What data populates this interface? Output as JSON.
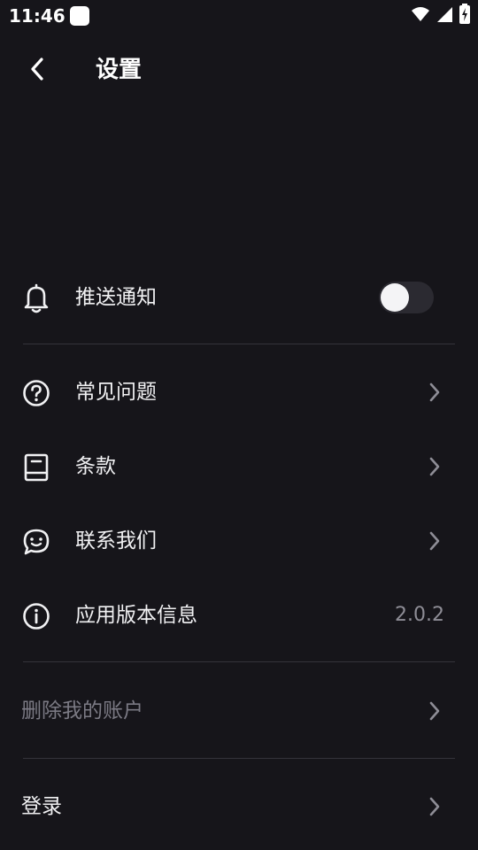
{
  "status_bar": {
    "time": "11:46"
  },
  "header": {
    "title": "设置"
  },
  "settings": {
    "notifications": {
      "label": "推送通知",
      "enabled": false
    },
    "faq": {
      "label": "常见问题"
    },
    "terms": {
      "label": "条款"
    },
    "contact": {
      "label": "联系我们"
    },
    "version": {
      "label": "应用版本信息",
      "value": "2.0.2"
    },
    "delete_account": {
      "label": "删除我的账户"
    },
    "login": {
      "label": "登录"
    }
  },
  "colors": {
    "background": "#16151a",
    "divider": "#34333a",
    "muted_text": "#7b7a84"
  }
}
